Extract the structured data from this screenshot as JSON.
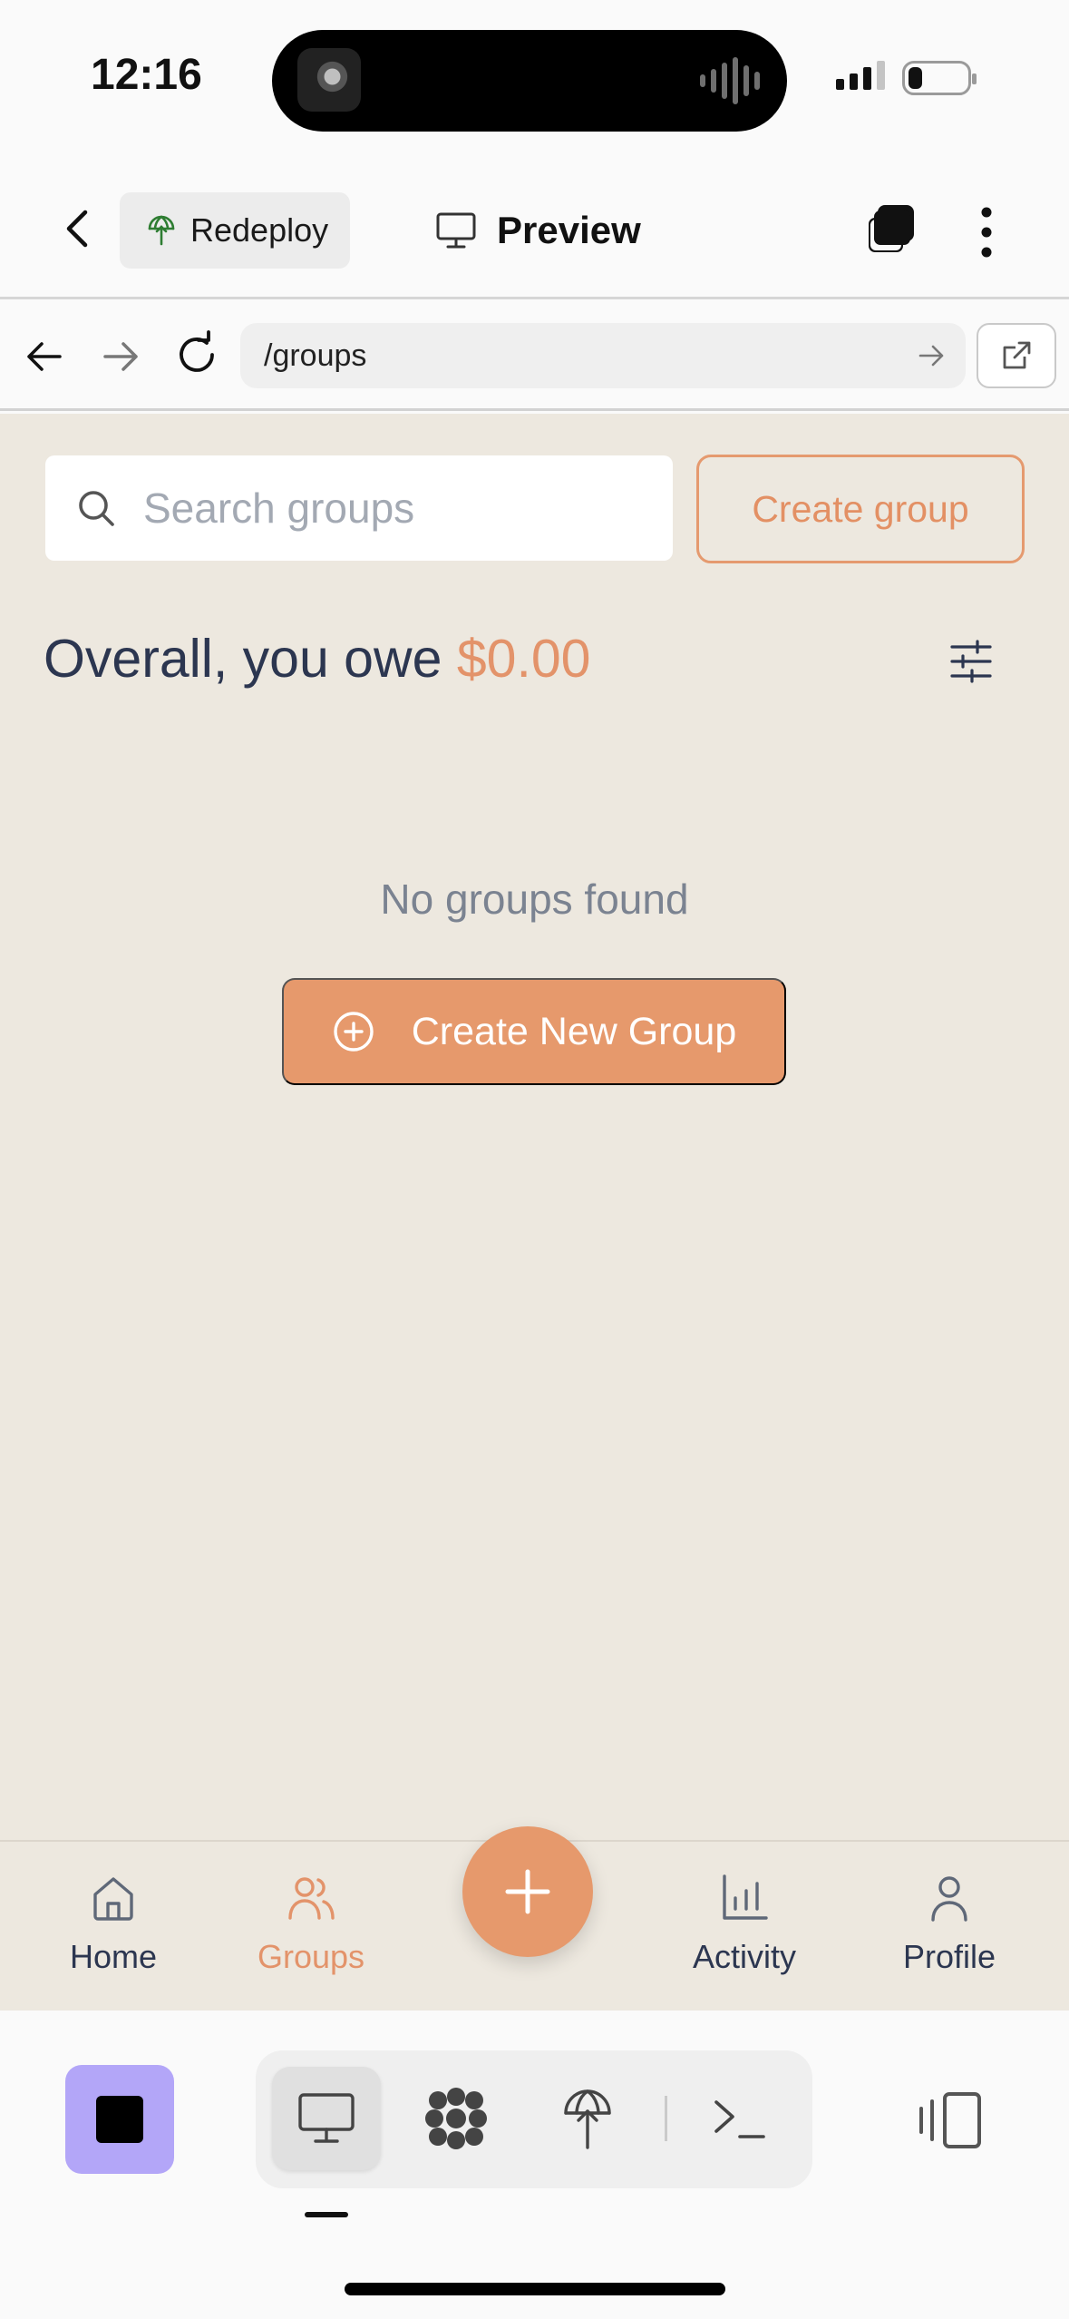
{
  "status_bar": {
    "time": "12:16"
  },
  "top_bar": {
    "redeploy_label": "Redeploy",
    "preview_label": "Preview"
  },
  "browser": {
    "url": "/groups"
  },
  "search": {
    "placeholder": "Search groups",
    "value": ""
  },
  "actions": {
    "create_group_label": "Create group",
    "create_new_group_label": "Create New Group"
  },
  "summary": {
    "prefix": "Overall, you owe",
    "amount": "$0.00"
  },
  "empty_state": {
    "message": "No groups found"
  },
  "bottom_nav": {
    "items": [
      {
        "label": "Home",
        "icon": "home-icon",
        "active": false
      },
      {
        "label": "Groups",
        "icon": "users-icon",
        "active": true
      },
      {
        "label": "Activity",
        "icon": "bar-chart-icon",
        "active": false
      },
      {
        "label": "Profile",
        "icon": "user-icon",
        "active": false
      }
    ]
  },
  "dev_toolbar": {
    "tools": [
      "monitor-icon",
      "apps-grid-icon",
      "deploy-icon",
      "terminal-icon"
    ],
    "active_tool": "monitor-icon"
  },
  "colors": {
    "accent": "#e6996c",
    "accent_text": "#e3936a",
    "content_bg": "#ede8df",
    "text_dark": "#2c3650",
    "muted": "#7b8391",
    "stop_button": "#b3a6f8"
  }
}
